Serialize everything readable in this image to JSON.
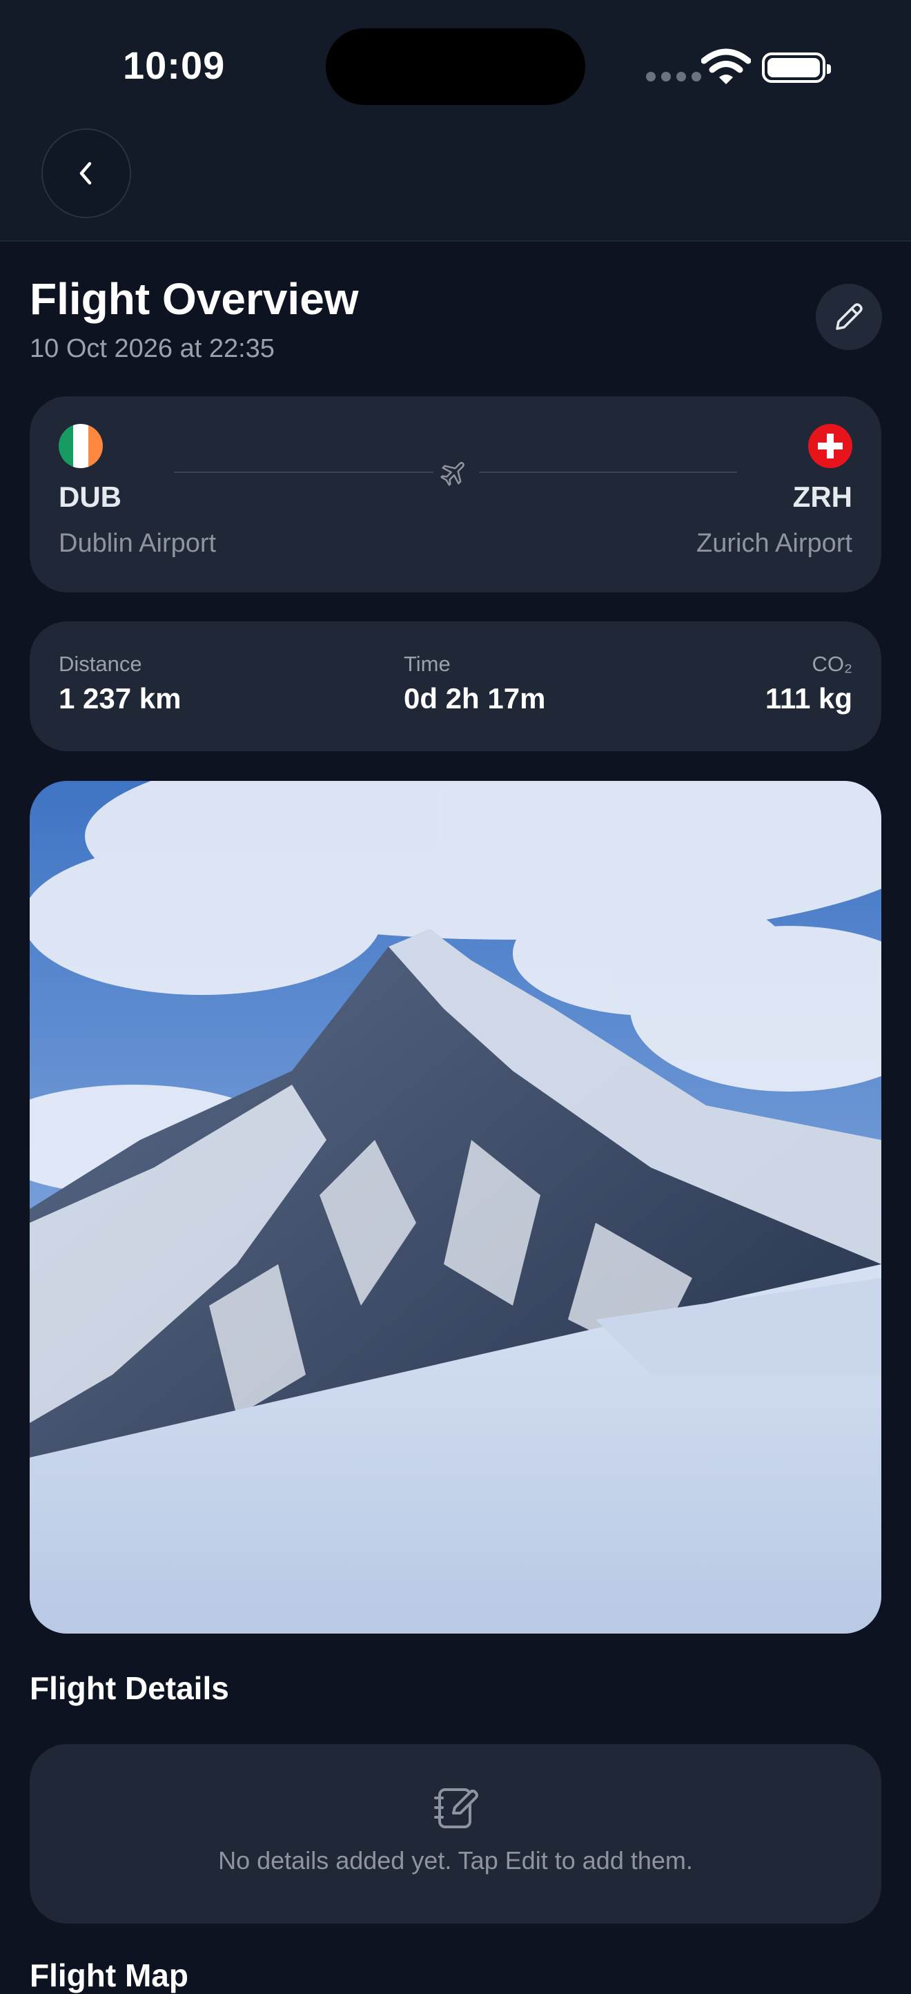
{
  "status_bar": {
    "time": "10:09"
  },
  "header": {
    "back_icon": "chevron-left-icon",
    "edit_icon": "pencil-icon"
  },
  "overview": {
    "title": "Flight Overview",
    "subtitle": "10 Oct 2026 at 22:35"
  },
  "route": {
    "origin": {
      "code": "DUB",
      "name": "Dublin Airport",
      "flag": "ireland-flag-icon",
      "flag_colors": [
        "#169b62",
        "#ffffff",
        "#ff883e"
      ]
    },
    "destination": {
      "code": "ZRH",
      "name": "Zurich Airport",
      "flag": "switzerland-flag-icon",
      "flag_colors": [
        "#e7141c",
        "#ffffff"
      ]
    },
    "separator_icon": "airplane-icon"
  },
  "stats": [
    {
      "label": "Distance",
      "value": "1 237 km"
    },
    {
      "label": "Time",
      "value": "0d 2h 17m"
    },
    {
      "label": "CO₂",
      "value": "111 kg"
    }
  ],
  "photo": {
    "subject": "snow-covered mountain peak under a blue, cloudy sky"
  },
  "flight_details": {
    "title": "Flight Details",
    "icon": "notebook-edit-icon",
    "empty_text": "No details added yet. Tap Edit to add them."
  },
  "flight_map": {
    "title": "Flight Map"
  },
  "colors": {
    "background": "#0d1320",
    "card": "#202838",
    "header": "#131a28",
    "muted_text": "#9aa1ad"
  }
}
